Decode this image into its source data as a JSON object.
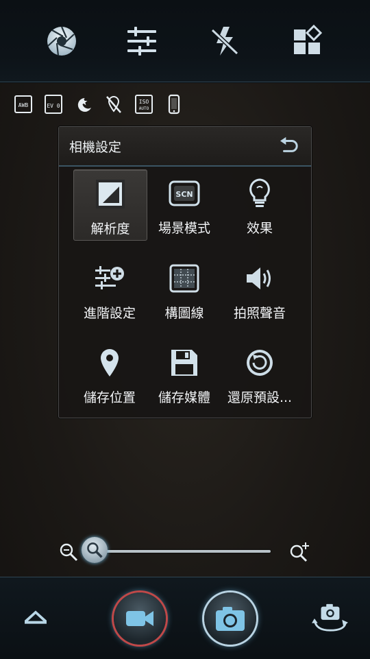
{
  "top_toolbar": {
    "items": [
      {
        "icon": "aperture-icon"
      },
      {
        "icon": "sliders-icon"
      },
      {
        "icon": "flash-off-icon"
      },
      {
        "icon": "mode-grid-icon"
      }
    ]
  },
  "status_icons": [
    {
      "icon": "awb-icon",
      "text": "AWB"
    },
    {
      "icon": "ev-icon",
      "text": "EV 0"
    },
    {
      "icon": "night-mode-icon"
    },
    {
      "icon": "location-off-icon"
    },
    {
      "icon": "iso-auto-icon",
      "text": "ISO AUTO"
    },
    {
      "icon": "phone-storage-icon"
    }
  ],
  "panel": {
    "title": "相機設定",
    "items": [
      {
        "label": "解析度",
        "icon": "resolution-icon",
        "selected": true
      },
      {
        "label": "場景模式",
        "icon": "scene-icon",
        "icon_text": "SCN"
      },
      {
        "label": "效果",
        "icon": "bulb-icon"
      },
      {
        "label": "進階設定",
        "icon": "advanced-settings-icon"
      },
      {
        "label": "構圖線",
        "icon": "grid-lines-icon"
      },
      {
        "label": "拍照聲音",
        "icon": "sound-icon"
      },
      {
        "label": "儲存位置",
        "icon": "location-pin-icon"
      },
      {
        "label": "儲存媒體",
        "icon": "save-media-icon"
      },
      {
        "label": "還原預設...",
        "icon": "restore-icon"
      }
    ]
  },
  "zoom": {
    "level_fraction": 0.05
  },
  "bottom_bar": {
    "items": [
      {
        "icon": "chevron-up-icon"
      },
      {
        "icon": "video-camera-icon"
      },
      {
        "icon": "camera-icon"
      },
      {
        "icon": "switch-camera-icon"
      }
    ]
  },
  "colors": {
    "accent_blue": "#7fc4e6",
    "icon_light": "#dbe7ee",
    "record_ring": "#c04848"
  }
}
